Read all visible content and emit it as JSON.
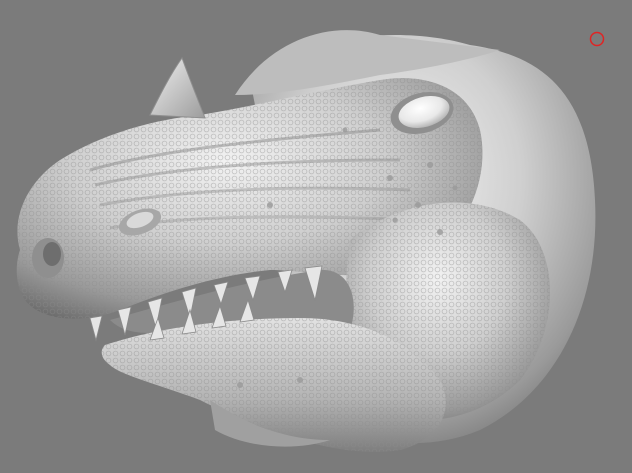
{
  "viewport": {
    "background_color": "#7b7b7b",
    "model_name_icon": "dinosaur-head-3d-model",
    "model_color": "#cfcfcf",
    "marker": {
      "icon": "pivot-circle-icon",
      "color": "#e02424"
    }
  }
}
